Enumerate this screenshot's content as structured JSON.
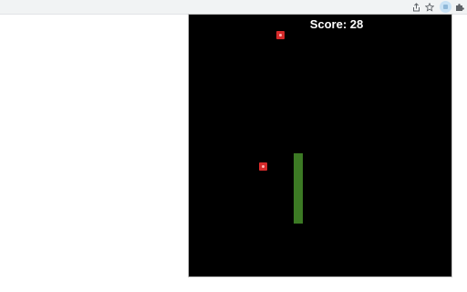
{
  "browser": {
    "toolbar_icons": [
      "share-icon",
      "star-icon",
      "extension-active-icon",
      "puzzle-icon"
    ]
  },
  "game": {
    "score_text": "Score: 28",
    "colors": {
      "background": "#000000",
      "snake": "#3c7a24",
      "apple": "#d42a2a",
      "text": "#ffffff"
    }
  }
}
